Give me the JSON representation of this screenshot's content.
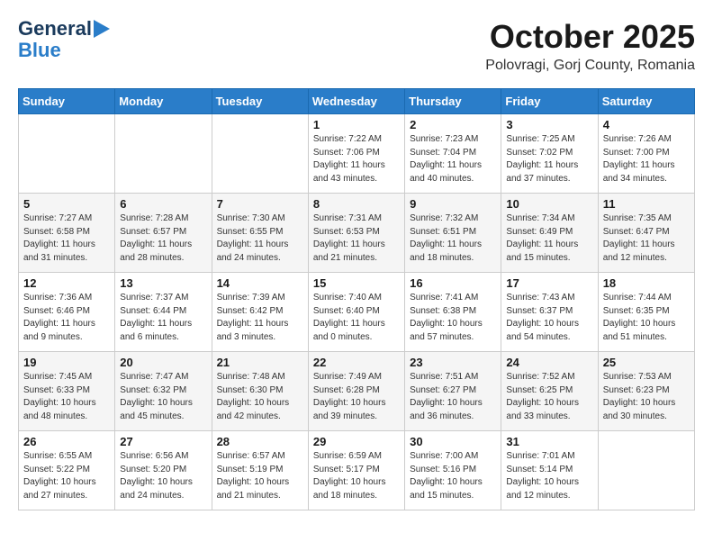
{
  "logo": {
    "general": "General",
    "blue": "Blue"
  },
  "title": {
    "month": "October 2025",
    "location": "Polovragi, Gorj County, Romania"
  },
  "weekdays": [
    "Sunday",
    "Monday",
    "Tuesday",
    "Wednesday",
    "Thursday",
    "Friday",
    "Saturday"
  ],
  "weeks": [
    [
      {
        "day": "",
        "info": ""
      },
      {
        "day": "",
        "info": ""
      },
      {
        "day": "",
        "info": ""
      },
      {
        "day": "1",
        "info": "Sunrise: 7:22 AM\nSunset: 7:06 PM\nDaylight: 11 hours\nand 43 minutes."
      },
      {
        "day": "2",
        "info": "Sunrise: 7:23 AM\nSunset: 7:04 PM\nDaylight: 11 hours\nand 40 minutes."
      },
      {
        "day": "3",
        "info": "Sunrise: 7:25 AM\nSunset: 7:02 PM\nDaylight: 11 hours\nand 37 minutes."
      },
      {
        "day": "4",
        "info": "Sunrise: 7:26 AM\nSunset: 7:00 PM\nDaylight: 11 hours\nand 34 minutes."
      }
    ],
    [
      {
        "day": "5",
        "info": "Sunrise: 7:27 AM\nSunset: 6:58 PM\nDaylight: 11 hours\nand 31 minutes."
      },
      {
        "day": "6",
        "info": "Sunrise: 7:28 AM\nSunset: 6:57 PM\nDaylight: 11 hours\nand 28 minutes."
      },
      {
        "day": "7",
        "info": "Sunrise: 7:30 AM\nSunset: 6:55 PM\nDaylight: 11 hours\nand 24 minutes."
      },
      {
        "day": "8",
        "info": "Sunrise: 7:31 AM\nSunset: 6:53 PM\nDaylight: 11 hours\nand 21 minutes."
      },
      {
        "day": "9",
        "info": "Sunrise: 7:32 AM\nSunset: 6:51 PM\nDaylight: 11 hours\nand 18 minutes."
      },
      {
        "day": "10",
        "info": "Sunrise: 7:34 AM\nSunset: 6:49 PM\nDaylight: 11 hours\nand 15 minutes."
      },
      {
        "day": "11",
        "info": "Sunrise: 7:35 AM\nSunset: 6:47 PM\nDaylight: 11 hours\nand 12 minutes."
      }
    ],
    [
      {
        "day": "12",
        "info": "Sunrise: 7:36 AM\nSunset: 6:46 PM\nDaylight: 11 hours\nand 9 minutes."
      },
      {
        "day": "13",
        "info": "Sunrise: 7:37 AM\nSunset: 6:44 PM\nDaylight: 11 hours\nand 6 minutes."
      },
      {
        "day": "14",
        "info": "Sunrise: 7:39 AM\nSunset: 6:42 PM\nDaylight: 11 hours\nand 3 minutes."
      },
      {
        "day": "15",
        "info": "Sunrise: 7:40 AM\nSunset: 6:40 PM\nDaylight: 11 hours\nand 0 minutes."
      },
      {
        "day": "16",
        "info": "Sunrise: 7:41 AM\nSunset: 6:38 PM\nDaylight: 10 hours\nand 57 minutes."
      },
      {
        "day": "17",
        "info": "Sunrise: 7:43 AM\nSunset: 6:37 PM\nDaylight: 10 hours\nand 54 minutes."
      },
      {
        "day": "18",
        "info": "Sunrise: 7:44 AM\nSunset: 6:35 PM\nDaylight: 10 hours\nand 51 minutes."
      }
    ],
    [
      {
        "day": "19",
        "info": "Sunrise: 7:45 AM\nSunset: 6:33 PM\nDaylight: 10 hours\nand 48 minutes."
      },
      {
        "day": "20",
        "info": "Sunrise: 7:47 AM\nSunset: 6:32 PM\nDaylight: 10 hours\nand 45 minutes."
      },
      {
        "day": "21",
        "info": "Sunrise: 7:48 AM\nSunset: 6:30 PM\nDaylight: 10 hours\nand 42 minutes."
      },
      {
        "day": "22",
        "info": "Sunrise: 7:49 AM\nSunset: 6:28 PM\nDaylight: 10 hours\nand 39 minutes."
      },
      {
        "day": "23",
        "info": "Sunrise: 7:51 AM\nSunset: 6:27 PM\nDaylight: 10 hours\nand 36 minutes."
      },
      {
        "day": "24",
        "info": "Sunrise: 7:52 AM\nSunset: 6:25 PM\nDaylight: 10 hours\nand 33 minutes."
      },
      {
        "day": "25",
        "info": "Sunrise: 7:53 AM\nSunset: 6:23 PM\nDaylight: 10 hours\nand 30 minutes."
      }
    ],
    [
      {
        "day": "26",
        "info": "Sunrise: 6:55 AM\nSunset: 5:22 PM\nDaylight: 10 hours\nand 27 minutes."
      },
      {
        "day": "27",
        "info": "Sunrise: 6:56 AM\nSunset: 5:20 PM\nDaylight: 10 hours\nand 24 minutes."
      },
      {
        "day": "28",
        "info": "Sunrise: 6:57 AM\nSunset: 5:19 PM\nDaylight: 10 hours\nand 21 minutes."
      },
      {
        "day": "29",
        "info": "Sunrise: 6:59 AM\nSunset: 5:17 PM\nDaylight: 10 hours\nand 18 minutes."
      },
      {
        "day": "30",
        "info": "Sunrise: 7:00 AM\nSunset: 5:16 PM\nDaylight: 10 hours\nand 15 minutes."
      },
      {
        "day": "31",
        "info": "Sunrise: 7:01 AM\nSunset: 5:14 PM\nDaylight: 10 hours\nand 12 minutes."
      },
      {
        "day": "",
        "info": ""
      }
    ]
  ]
}
